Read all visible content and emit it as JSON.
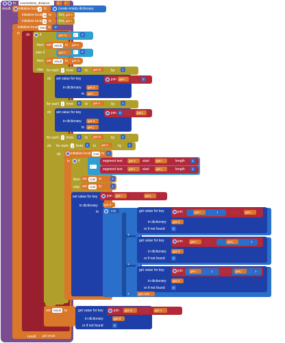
{
  "proc": {
    "keyword": "to",
    "name": "Levenshtein_distance",
    "params": [
      "s",
      "t"
    ],
    "result": "result"
  },
  "labels": {
    "init_local": "initialize local",
    "to": "to",
    "in": "in",
    "create_dict": "create empty dictionary",
    "length": "length",
    "get": "get",
    "do": "do",
    "if": "if",
    "then": "then",
    "else_if": "else if",
    "else": "else",
    "set": "set",
    "for_each": "for each",
    "from": "from",
    "by": "by",
    "set_value_for_key": "set value for key",
    "in_dictionary": "in dictionary",
    "join": "join",
    "segment_text": "segment text",
    "start": "start",
    "min": "min",
    "or_if_not_found": "or if not found",
    "get_value_for_key": "get value for key",
    "result": "result",
    "plus": "+",
    "eq": "=",
    "and": "and"
  },
  "vars": {
    "d": "d",
    "m": "m",
    "n": "n",
    "result": "result",
    "cost": "cost",
    "i": "i",
    "j": "j",
    "s": "s",
    "t": "t"
  },
  "nums": {
    "zero": "0",
    "one": "1",
    "blank": " "
  },
  "icons": [
    "gear-icon",
    "mutator-icon"
  ]
}
